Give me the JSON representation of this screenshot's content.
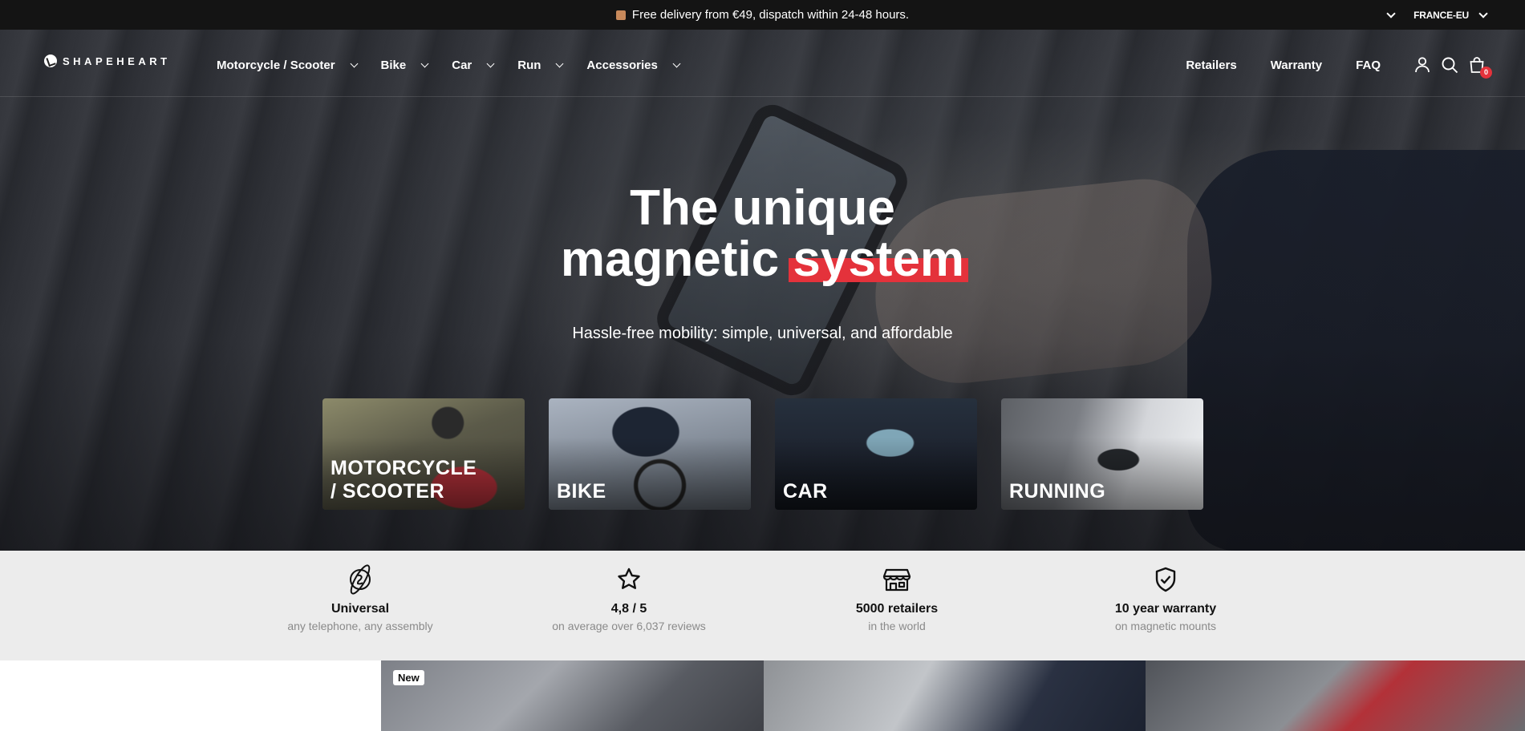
{
  "announcement": {
    "text": "Free delivery from €49, dispatch within 24-48 hours.",
    "region": "FRANCE-EU"
  },
  "header": {
    "logo": "SHAPEHEART",
    "nav": [
      {
        "label": "Motorcycle / Scooter"
      },
      {
        "label": "Bike"
      },
      {
        "label": "Car"
      },
      {
        "label": "Run"
      },
      {
        "label": "Accessories"
      }
    ],
    "links": [
      {
        "label": "Retailers"
      },
      {
        "label": "Warranty"
      },
      {
        "label": "FAQ"
      }
    ],
    "icons": [
      "account-icon",
      "search-icon",
      "cart-icon"
    ],
    "cart_count": "0"
  },
  "hero": {
    "title_line1": "The unique",
    "title_line2": "magnetic",
    "title_highlight": "system",
    "subtitle": "Hassle-free mobility: simple, universal, and affordable",
    "highlight_color": "#e4323b"
  },
  "categories": [
    {
      "line1": "MOTORCYCLE",
      "line2": "/ SCOOTER"
    },
    {
      "line1": "BIKE",
      "line2": ""
    },
    {
      "line1": "CAR",
      "line2": ""
    },
    {
      "line1": "RUNNING",
      "line2": ""
    }
  ],
  "features": [
    {
      "icon": "globe-orbit-icon",
      "title": "Universal",
      "subtitle": "any telephone, any assembly"
    },
    {
      "icon": "star-icon",
      "title": "4,8 / 5",
      "subtitle": "on average over 6,037 reviews"
    },
    {
      "icon": "store-icon",
      "title": "5000 retailers",
      "subtitle": "in the world"
    },
    {
      "icon": "shield-check-icon",
      "title": "10 year warranty",
      "subtitle": "on magnetic mounts"
    }
  ],
  "products": {
    "badge": "New"
  }
}
